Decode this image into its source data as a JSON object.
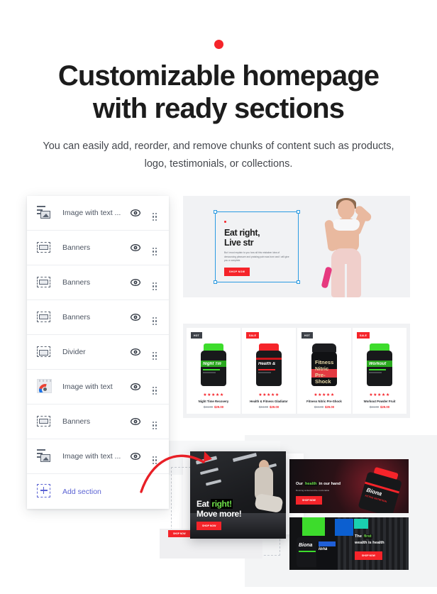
{
  "header": {
    "accent_dot_color": "#f5242a",
    "title": "Customizable homepage with ready sections",
    "subtitle": "You can easily add, reorder, and remove chunks of content such as products, logo, testimonials, or collections."
  },
  "sidebar": {
    "items": [
      {
        "label": "Image with text ...",
        "icon": "image-with-text-icon",
        "eye": "eye-icon",
        "grip": "drag-handle-icon"
      },
      {
        "label": "Banners",
        "icon": "banners-icon",
        "eye": "eye-icon",
        "grip": "drag-handle-icon"
      },
      {
        "label": "Banners",
        "icon": "banners-icon",
        "eye": "eye-icon",
        "grip": "drag-handle-icon"
      },
      {
        "label": "Banners",
        "icon": "banners-icon",
        "eye": "eye-icon",
        "grip": "drag-handle-icon"
      },
      {
        "label": "Divider",
        "icon": "divider-icon",
        "eye": "eye-icon",
        "grip": "drag-handle-icon"
      },
      {
        "label": "Image with text",
        "icon": "image-thumbnail-icon",
        "eye": "eye-icon",
        "grip": "drag-handle-icon"
      },
      {
        "label": "Banners",
        "icon": "banners-icon",
        "eye": "eye-icon",
        "grip": "drag-handle-icon"
      },
      {
        "label": "Image with text ...",
        "icon": "image-with-text-icon",
        "eye": "eye-icon",
        "grip": "drag-handle-icon"
      }
    ],
    "add_section": {
      "label": "Add section",
      "icon": "add-plus-icon",
      "color": "#5b63d3"
    }
  },
  "hero_preview": {
    "heading_line1": "Eat right,",
    "heading_line2": "Live str",
    "paragraph": "But i must explain to you how all this mistaken idea of denouncing pleasure and praising pain was born and I will give you a complete.",
    "button_label": "SHOP NOW",
    "accent_color": "#f5242a",
    "selection_color": "#2a9ae1",
    "background": "#f1f2f4"
  },
  "products": {
    "background": "#f1f2f4",
    "items": [
      {
        "badge": "HOT",
        "badge_type": "hot",
        "name": "Night Time Recovery",
        "stars": "★★★★★",
        "old_price": "$44.00",
        "new_price": "$29.00",
        "cap_color": "#3ddc2c",
        "band_color": "#2aa81f"
      },
      {
        "badge": "SALE",
        "badge_type": "sale",
        "name": "Health & Fitness Gladiator",
        "stars": "★★★★★",
        "old_price": "$44.00",
        "new_price": "$29.00",
        "cap_color": "#f5242a",
        "band_color": "#c9161c"
      },
      {
        "badge": "HOT",
        "badge_type": "hot",
        "name": "Fitness Nitric Pre-Shock",
        "stars": "★★★★★",
        "old_price": "$44.00",
        "new_price": "$29.00",
        "cap_color": "#1c1d20",
        "band_color": "#e33a42"
      },
      {
        "badge": "SALE",
        "badge_type": "sale",
        "name": "Workout Powder Fruit",
        "stars": "★★★★★",
        "old_price": "$44.00",
        "new_price": "$29.00",
        "cap_color": "#3ddc2c",
        "band_color": "#2aa81f"
      }
    ]
  },
  "bottom_preview": {
    "gym_card": {
      "heading_line1_plain": "Eat ",
      "heading_line1_accent": "right!",
      "heading_line2": "Move more!",
      "button_label": "SHOP NOW"
    },
    "ghost_button_label": "SHOP NOW",
    "banner_one": {
      "heading_plain_before": "Our ",
      "heading_accent": "health",
      "heading_plain_after": " in our hand",
      "paragraph": "Running smiled and be comfortable",
      "button_label": "SHOP NOW",
      "product_brand": "Biona",
      "product_sub": "ACTIVE NUTRITION"
    },
    "banner_two": {
      "heading_plain": "The ",
      "heading_accent": "first",
      "heading_line2": "wealth is health",
      "button_label": "SHOP NOW",
      "product_brand_1": "Biona",
      "product_brand_2": "iona"
    },
    "arrow_color": "#e81f26"
  }
}
